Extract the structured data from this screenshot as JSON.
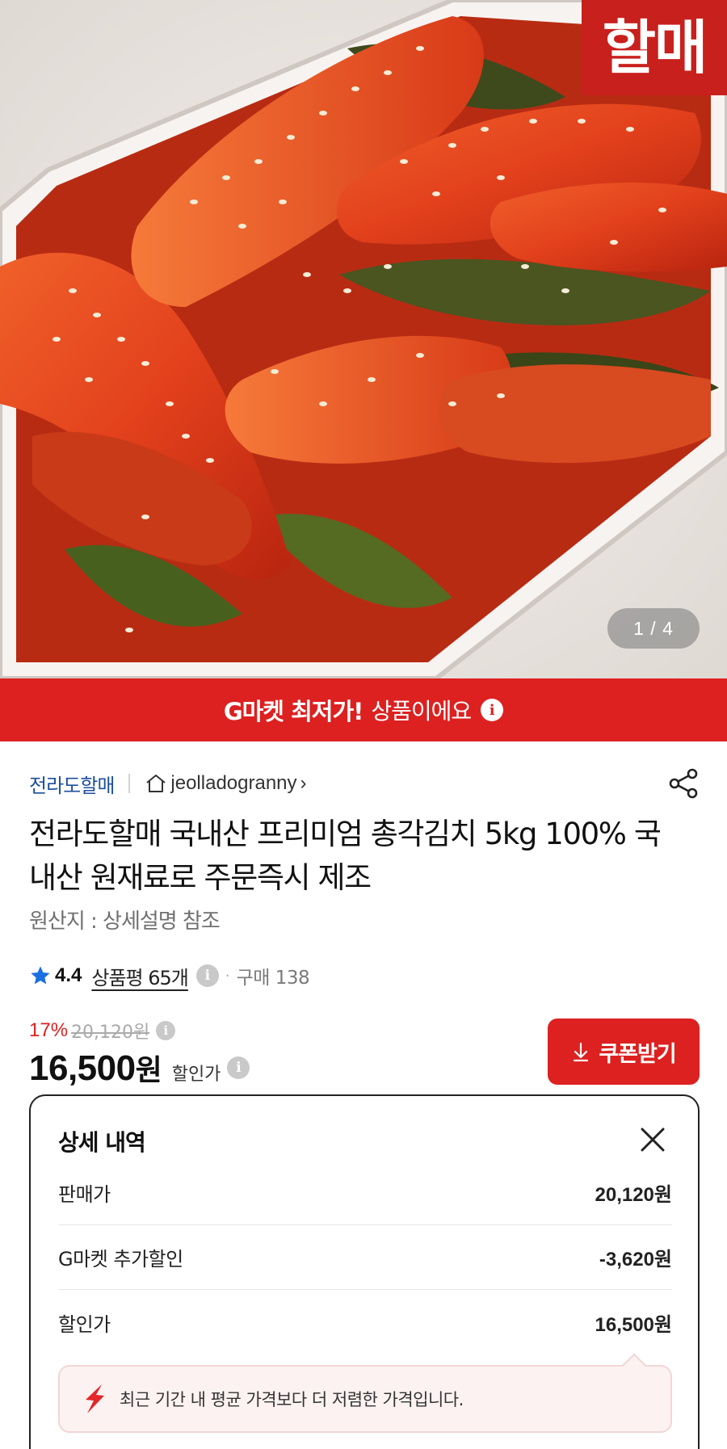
{
  "hero": {
    "brand_stamp_text": "할매",
    "image_counter": "1 / 4"
  },
  "banner": {
    "strong_text": "G마켓 최저가!",
    "normal_text": "상품이에요",
    "color": "#dc2120"
  },
  "seller": {
    "name": "전라도할매",
    "shop_link": "jeolladogranny",
    "link_color": "#1e4f9c"
  },
  "product": {
    "title": "전라도할매 국내산 프리미엄 총각김치 5kg 100% 국내산 원재료로 주문즉시 제조",
    "origin": "원산지 : 상세설명 참조"
  },
  "rating": {
    "score": "4.4",
    "review_label": "상품평 65개",
    "purchase_label": "구매 138"
  },
  "price": {
    "discount_pct": "17%",
    "original_price": "20,120원",
    "sale_price_number": "16,500",
    "sale_price_unit": "원",
    "sale_price_label": "할인가",
    "coupon_button_label": "쿠폰받기"
  },
  "detail": {
    "title": "상세 내역",
    "rows": [
      {
        "label": "판매가",
        "value": "20,120원"
      },
      {
        "label": "G마켓 추가할인",
        "value": "-3,620원"
      },
      {
        "label": "할인가",
        "value": "16,500원"
      }
    ],
    "notice": "최근 기간 내 평균 가격보다 더 저렴한 가격입니다."
  }
}
